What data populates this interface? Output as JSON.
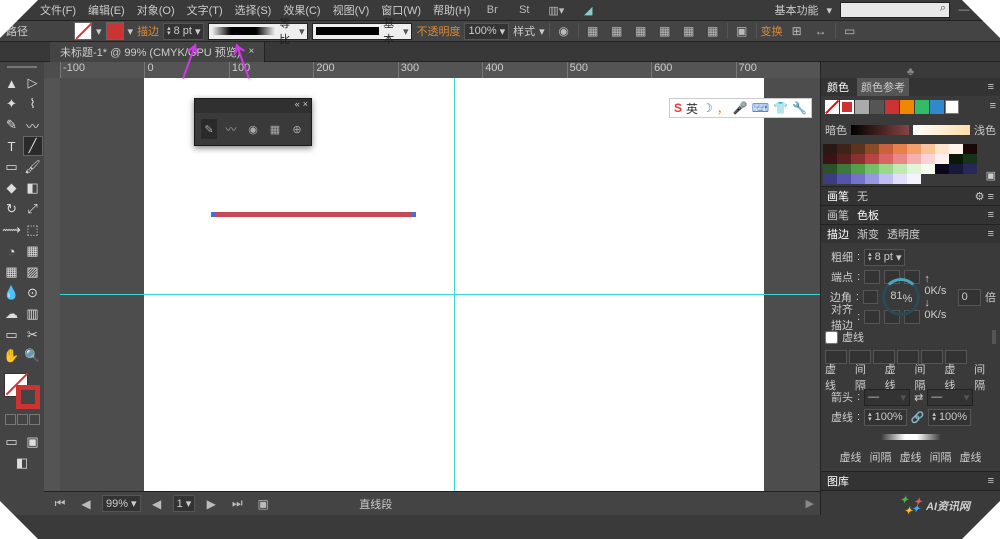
{
  "menu": {
    "items": [
      "文件(F)",
      "编辑(E)",
      "对象(O)",
      "文字(T)",
      "选择(S)",
      "效果(C)",
      "视图(V)",
      "窗口(W)",
      "帮助(H)"
    ],
    "right_label": "基本功能"
  },
  "ctrl": {
    "path": "路径",
    "stroke": "描边",
    "weight": "8 pt",
    "profile": "等比",
    "brush": "基本",
    "opacity": "不透明度",
    "opacity_val": "100%",
    "style": "样式",
    "transform": "变换"
  },
  "doc": {
    "tab": "未标题-1* @ 99% (CMYK/GPU 预览)",
    "status_tool": "直线段",
    "zoom": "99%",
    "page": "1"
  },
  "ruler": [
    "-100",
    "0",
    "100",
    "200",
    "300",
    "400",
    "500",
    "600",
    "700"
  ],
  "ime": {
    "lang": "英"
  },
  "rp": {
    "color": "颜色",
    "color_ref": "颜色参考",
    "dark": "暗色",
    "light": "浅色",
    "brush": "画笔",
    "swatch": "色板",
    "none": "无",
    "stroke": "描边",
    "grad": "渐变",
    "trans": "透明度",
    "weight": "粗细",
    "weight_val": "8 pt",
    "cap": "端点",
    "corner": "边角",
    "corner_val": "0",
    "limit": "倍",
    "align": "对齐描边",
    "dash": "虚线",
    "d1": "虚线",
    "d2": "间隔",
    "arrow": "箭头",
    "taper": "虚线",
    "pct100": "100%",
    "lib": "图库",
    "progress": "81",
    "ks": "0K/s"
  },
  "watermark": "AI资讯网"
}
